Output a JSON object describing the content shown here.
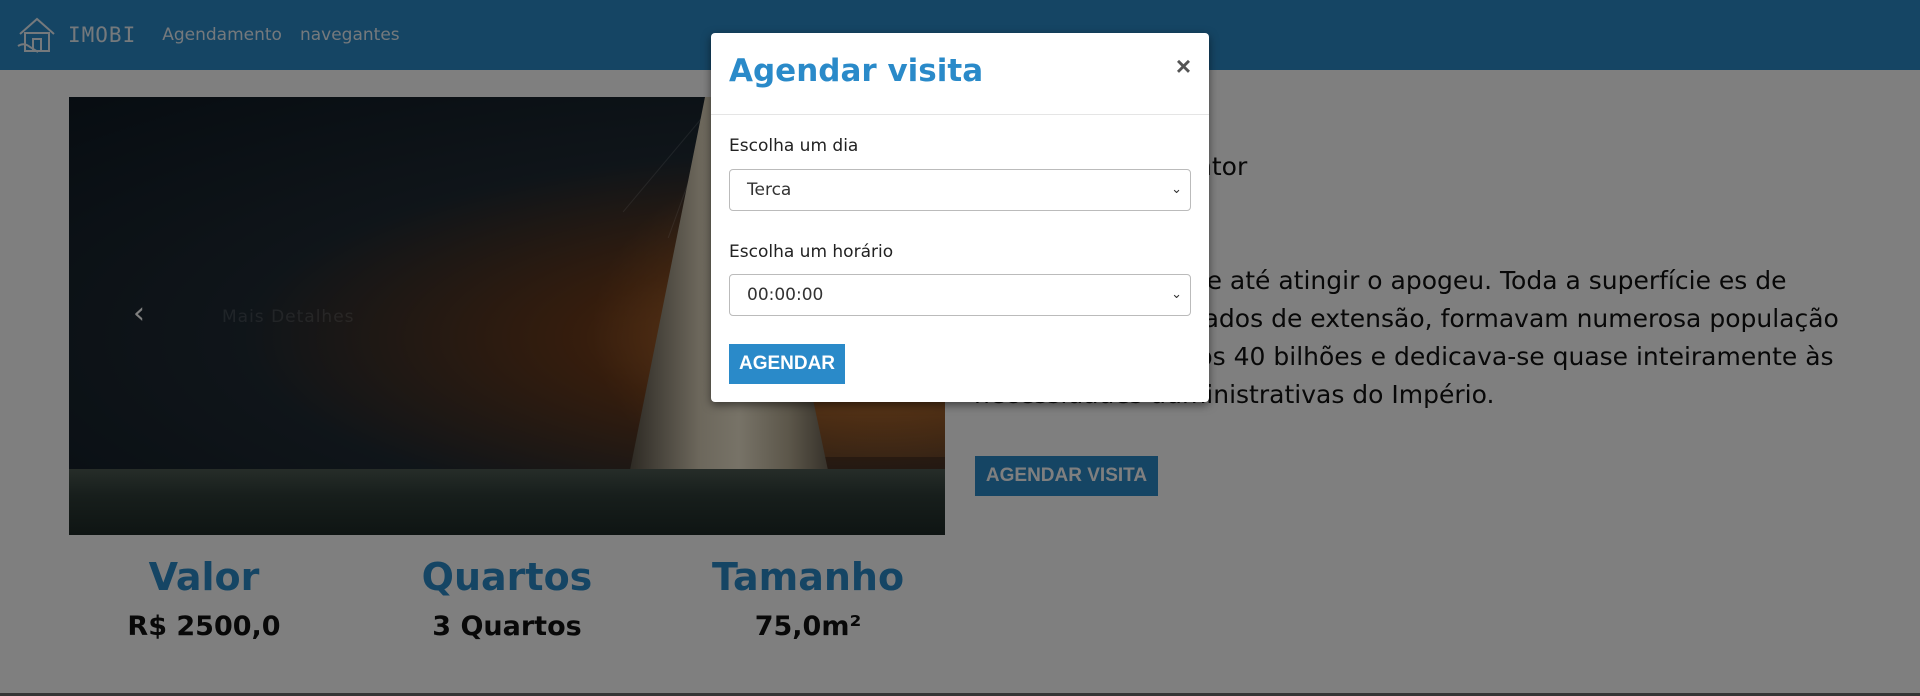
{
  "navbar": {
    "brand": "IMOBI",
    "links": [
      "Agendamento",
      "navegantes"
    ]
  },
  "carousel": {
    "caption": "Mais Detalhes",
    "prev_icon": "chevron-left-icon"
  },
  "stats": [
    {
      "heading": "Valor",
      "value": "R$ 2500,0"
    },
    {
      "heading": "Quartos",
      "value": "3 Quartos"
    },
    {
      "heading": "Tamanho",
      "value": "75,0m²"
    }
  ],
  "details": {
    "snippet": "ntor",
    "description": "grediu rapidamente até atingir o apogeu. Toda a superfície es de quilômetros quadrados de extensão, formavam numerosa população mal ultrapassava os 40 bilhões e dedicava-se quase inteiramente às necessidades administrativas do Império.",
    "button": "AGENDAR VISITA"
  },
  "modal": {
    "title": "Agendar visita",
    "close": "×",
    "day_label": "Escolha um dia",
    "day_value": "Terca",
    "time_label": "Escolha um horário",
    "time_value": "00:00:00",
    "submit": "AGENDAR"
  },
  "colors": {
    "accent": "#2a8ac9",
    "overlay": "rgba(0,0,0,0.5)"
  }
}
